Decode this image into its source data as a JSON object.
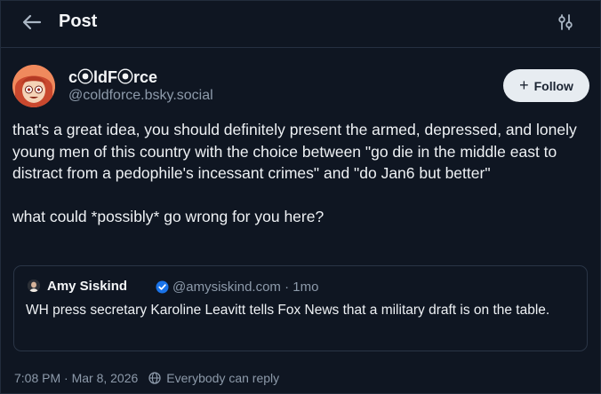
{
  "header": {
    "title": "Post"
  },
  "post": {
    "author": {
      "display_name": "c⦿ldF⦿rce",
      "handle": "@coldforce.bsky.social"
    },
    "follow_label": "Follow",
    "paragraphs": [
      "that's a great idea, you should definitely present the armed, depressed, and lonely young men of this country with the choice between \"go die in the middle east to distract from a pedophile's incessant crimes\" and \"do Jan6 but better\"",
      "what could *possibly* go wrong for you here?"
    ],
    "timestamp": "7:08 PM · Mar 8, 2026",
    "reply_setting": "Everybody can reply"
  },
  "quote": {
    "author_name": "Amy Siskind",
    "author_handle_time": "@amysiskind.com · 1mo",
    "text": "WH press secretary Karoline Leavitt tells Fox News that a military draft is on the table."
  },
  "colors": {
    "background": "#0f1622",
    "border": "#253041",
    "muted_text": "#8d9aaa",
    "verified_badge": "#1a73e8",
    "follow_button": "#e7ecf1"
  },
  "icons": {
    "back": "arrow-left-icon",
    "settings": "sliders-icon",
    "verified": "verified-check-icon",
    "reply_setting": "globe-icon"
  }
}
